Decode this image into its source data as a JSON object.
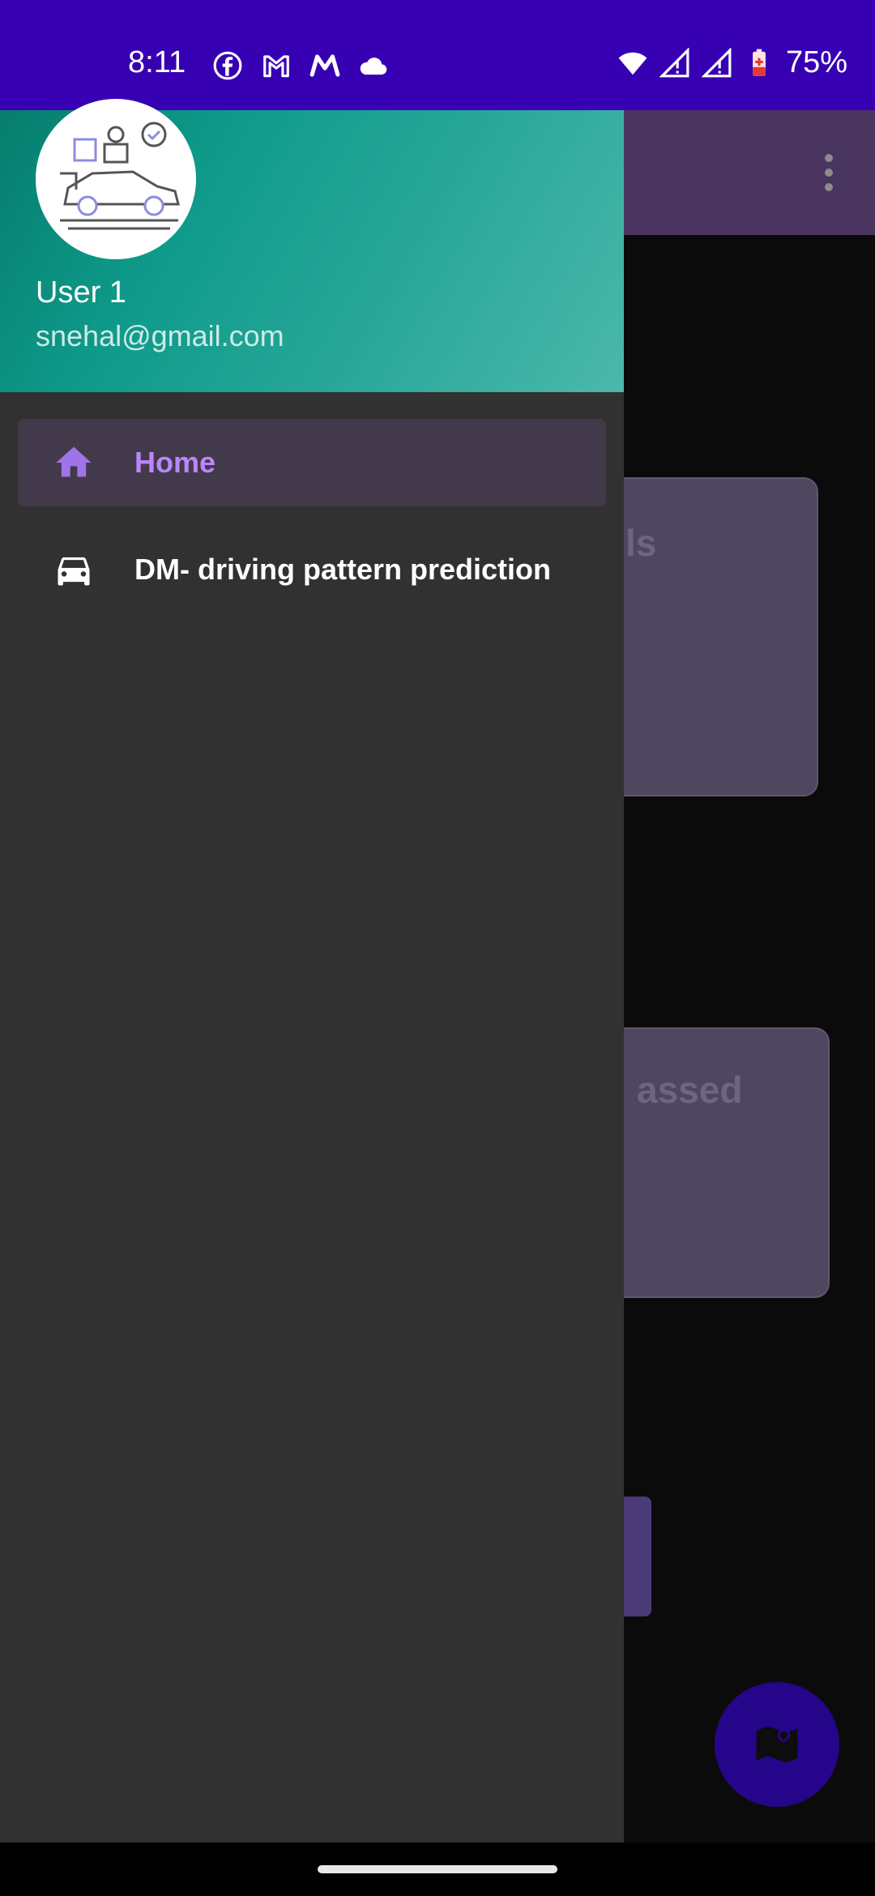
{
  "status_bar": {
    "time": "8:11",
    "battery": "75%",
    "icons_left": [
      "facebook-icon",
      "gmail-icon",
      "myntra-icon",
      "cloud-icon"
    ],
    "icons_right": [
      "wifi-icon",
      "signal-icon",
      "signal-icon",
      "battery-icon"
    ]
  },
  "background_app": {
    "card1_partial_text": "ls",
    "card2_partial_text": "assed"
  },
  "drawer": {
    "user_name": "User 1",
    "user_email": "snehal@gmail.com",
    "items": [
      {
        "label": "Home",
        "icon": "home-icon",
        "active": true
      },
      {
        "label": "DM- driving pattern prediction",
        "icon": "car-icon",
        "active": false
      }
    ]
  },
  "colors": {
    "status_bar": "#3700b3",
    "drawer_bg": "#313131",
    "accent": "#bb86fc",
    "header_gradient_start": "#067d6d",
    "header_gradient_end": "#4bb8ab"
  }
}
